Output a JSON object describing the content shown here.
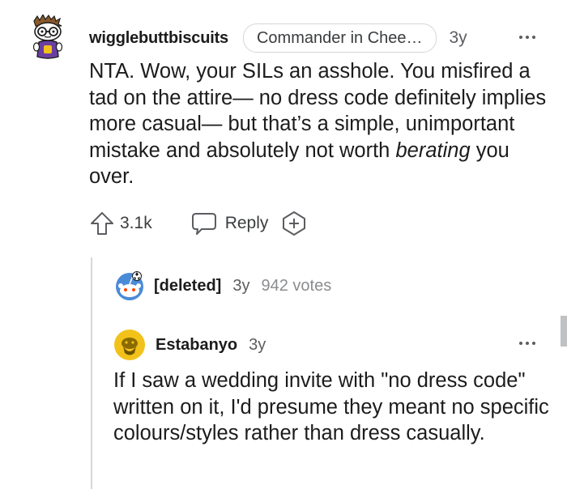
{
  "comment": {
    "username": "wigglebuttbiscuits",
    "flair": "Commander in Chee…",
    "age": "3y",
    "body_prefix": "NTA. Wow, your SILs an asshole. You misfired a tad on the attire— no dress code definitely implies more casual— but that’s a simple, unimportant mistake and absolutely not worth ",
    "body_emphasis": "berating",
    "body_suffix": " you over.",
    "upvote_icon": "upvote-arrow-icon",
    "score": "3.1k",
    "reply_icon": "speech-bubble-icon",
    "reply_label": "Reply",
    "award_icon": "add-award-icon",
    "more_icon": "more-options-icon"
  },
  "deleted_comment": {
    "username": "[deleted]",
    "age": "3y",
    "votes": "942 votes"
  },
  "reply": {
    "username": "Estabanyo",
    "age": "3y",
    "body": "If I saw a wedding invite with \"no dress code\" written on it, I'd presume they meant no specific colours/styles rather than dress casually.",
    "more_icon": "more-options-icon"
  },
  "colors": {
    "text_primary": "#1c1c1c",
    "text_secondary": "#5b5d60",
    "text_muted": "#8a8c8f",
    "thread_line": "#d6d7d9",
    "flair_border": "#d4d6d8",
    "avatar_yellow": "#f2c21a",
    "snoo_blue": "#4a8bd8"
  }
}
